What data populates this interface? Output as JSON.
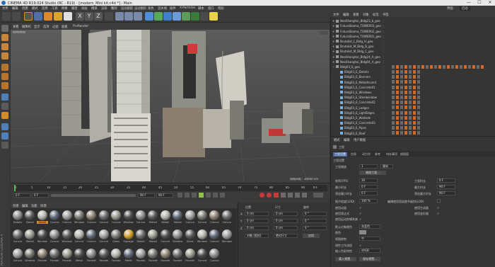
{
  "window": {
    "title": "CINEMA 4D R19.024 Studio (RC - R19) - [modern_Mini kit.c4d *] - Main",
    "minimize": "—",
    "maximize": "☐",
    "close": "✕"
  },
  "menubar": [
    "文件",
    "编辑",
    "创建",
    "模式",
    "选择",
    "工具",
    "网格",
    "捕捉",
    "动画",
    "模拟",
    "渲染",
    "雕刻",
    "运动跟踪",
    "运动图形",
    "角色",
    "流水线",
    "插件",
    "X-Particles",
    "脚本",
    "窗口",
    "帮助",
    "界面:",
    "启动"
  ],
  "main_toolbar": {
    "x_label": "X",
    "y_label": "Y",
    "z_label": "Z"
  },
  "viewport": {
    "menu": [
      "查看",
      "摄像机",
      "显示",
      "选项",
      "过滤",
      "面板",
      "ProRender"
    ],
    "name": "透视视图",
    "grid_spacing": "网格间距 : 10000 cm"
  },
  "timeline": {
    "ticks": [
      "0",
      "5",
      "10",
      "15",
      "20",
      "25",
      "30",
      "35",
      "40",
      "45",
      "50",
      "55",
      "60",
      "65",
      "70",
      "75",
      "80",
      "85",
      "90"
    ],
    "start_frame": "0 F",
    "preview_start": "0 F",
    "preview_end": "90 F",
    "end_frame": "90 F",
    "current_frame": "0 F"
  },
  "material_manager": {
    "menu": [
      "创建",
      "编辑",
      "功能",
      "纹理"
    ],
    "row1": [
      "Details",
      "Detail",
      "Detail",
      "Concre",
      "Concre",
      "Window",
      "Concre",
      "Concre",
      "Concre",
      "Window",
      "Concre",
      "Metall",
      "Metall",
      "Metall",
      "Concre",
      "Concre",
      "Concre",
      "Concre"
    ],
    "row2": [
      "Concre",
      "Metall",
      "Window",
      "Concre",
      "Window",
      "Concre",
      "Concre",
      "Concre",
      "Glass",
      "Signage",
      "Metall",
      "Metall",
      "Concre",
      "Window",
      "Glass",
      "Window",
      "Concre",
      "Window"
    ],
    "row3": [
      "Concre",
      "Window",
      "Facade",
      "Facade",
      "Facade",
      "Metal",
      "Facade",
      "Facade",
      "Facade",
      "Metal",
      "Facade",
      "Facade",
      "Facade",
      "Facade",
      "Facade",
      "Concre",
      "Concre"
    ]
  },
  "coordinates": {
    "headers": [
      "位置",
      "尺寸",
      "旋转"
    ],
    "x_label": "X",
    "y_label": "Y",
    "z_label": "Z",
    "px": "0 cm",
    "py": "0 cm",
    "pz": "0 cm",
    "sx": "0 cm",
    "sy": "0 cm",
    "sz": "0 cm",
    "rh": "0 °",
    "rp": "0 °",
    "rb": "0 °",
    "mode1": "对象 (相对)",
    "mode2": "绝对尺寸",
    "apply": "应用"
  },
  "object_manager": {
    "menu": [
      "文件",
      "编辑",
      "查看",
      "对象",
      "标签",
      "书签"
    ],
    "top_objects": [
      "NeoShanghai_Bldg23_b_geo",
      "FuturaSkama_TOWER03_geo",
      "FuturaSkama_TOWER02_geo",
      "FuturaSkama_TOWER01_geo",
      "Brutalist_L_Bldg_H_geo",
      "Brutalist_M_Bldg_B_geo",
      "Brutalist_M_Bldg_C_geo",
      "NeoShanghai_Bldg24_A_geo",
      "NeoShanghai_Bldg04_A_geo"
    ],
    "expanded_parent": "Bldg03_E_geo",
    "children": [
      "Bldg03_E_Details",
      "Bldg03_E_Banners",
      "Bldg03_E_MetalAccent",
      "Bldg03_E_Concrete01",
      "Bldg03_E_Windows",
      "Bldg03_E_Steelwindow",
      "Bldg03_E_Concrete02",
      "Bldg03_E_Ledges",
      "Bldg03_E_LightEdges",
      "Bldg03_E_Wallside",
      "Bldg03_E_Concrete03",
      "Bldg03_E_Pipes",
      "Bldg03_E_Roof"
    ]
  },
  "attribute_manager": {
    "menu": [
      "模式",
      "编辑",
      "用户数据"
    ],
    "section": "工程",
    "tabs": [
      "工程设置",
      "信息",
      "动力学",
      "参考",
      "待办事项",
      "帧插值"
    ],
    "subheader": "工程设置",
    "scale_label": "工程缩放",
    "scale_value": "1",
    "scale_unit": "厘米",
    "scale_button": "缩放工程...",
    "fps_label": "帧率(FPS)",
    "fps": "30",
    "project_time_label": "工程时长",
    "project_time": "0 F",
    "min_time_label": "最小时长",
    "min_time": "0 F",
    "max_time_label": "最大时长",
    "max_time": "90 F",
    "preview_min_label": "预览最小时长",
    "preview_min": "0 F",
    "preview_max_label": "预览最大时长",
    "preview_max": "90 F",
    "lod_label": "细节程度(LOD)",
    "lod": "100 %",
    "render_lod_label": "编辑使用渲染细节级别(LOD)",
    "use_anim_label": "使用动画",
    "use_expr_label": "使用表达式",
    "use_gen_label": "使用生成器",
    "use_deform_label": "使用变形器",
    "use_motion_label": "使用运动剪辑系统",
    "default_color_label": "默认对象颜色",
    "default_color": "灰蓝色",
    "color_label": "颜色",
    "view_clip_label": "视图修剪",
    "view_clip": "中",
    "linear_label": "线性工作流程",
    "input_color_label": "输入色彩特性",
    "input_color": "sRGB",
    "load_preset": "载入预置...",
    "save_preset": "保存预置..."
  },
  "side_label": "MAXON CINEMA 4D"
}
